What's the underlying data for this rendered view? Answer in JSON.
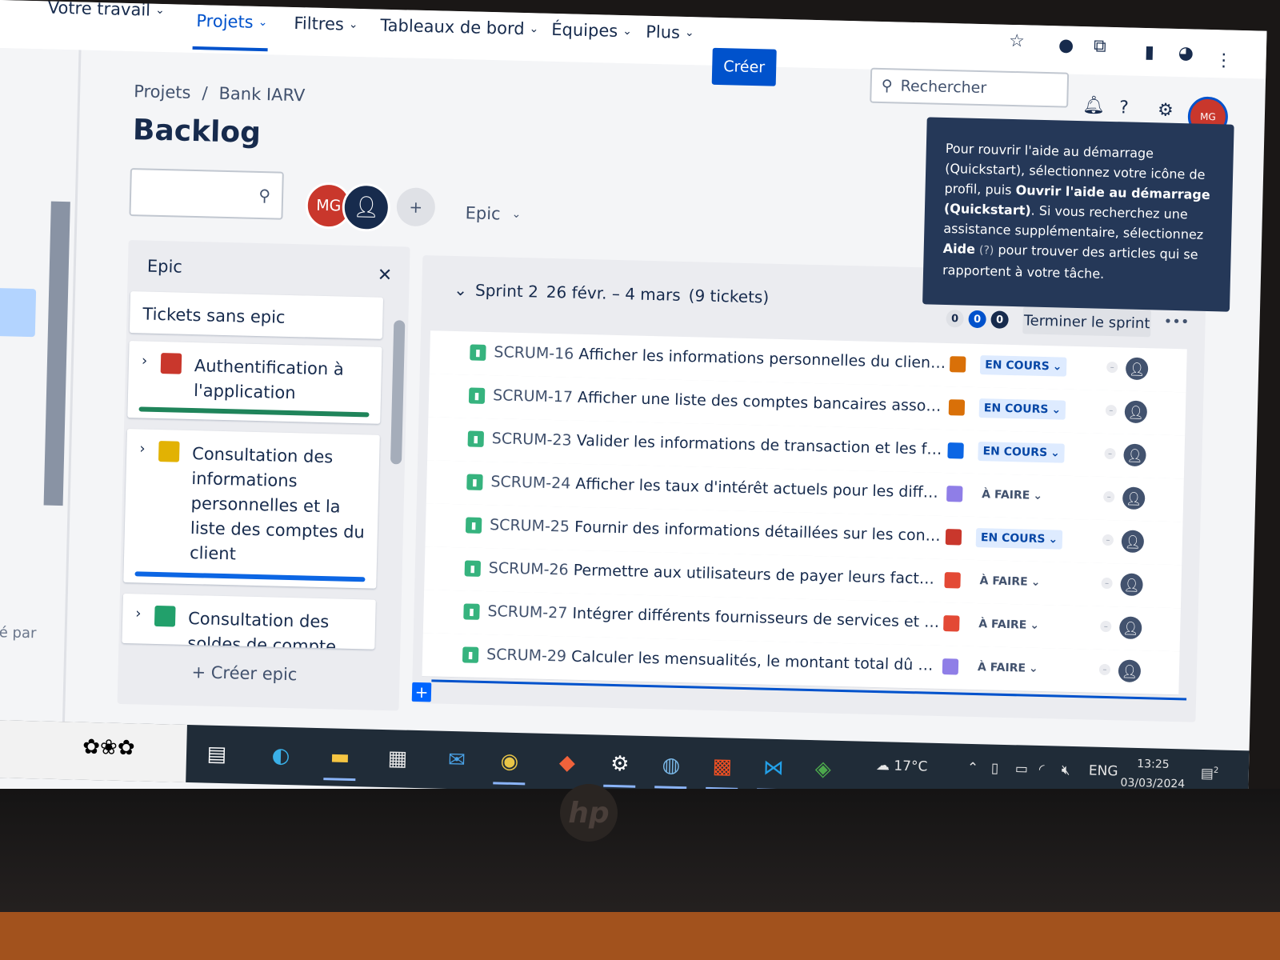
{
  "nav": {
    "items": [
      "Votre travail",
      "Projets",
      "Filtres",
      "Tableaux de bord",
      "Équipes",
      "Plus"
    ],
    "create_label": "Créer",
    "search_placeholder": "Rechercher",
    "profile_initials": "MG"
  },
  "breadcrumb": [
    "Projets",
    "/",
    "Bank IARV"
  ],
  "page_title": "Backlog",
  "toolbar": {
    "avatar_initials": "MG",
    "epic_filter_label": "Epic"
  },
  "left_rail": {
    "partial_text": "éré par"
  },
  "epic_panel": {
    "title": "Epic",
    "no_epic_label": "Tickets sans epic",
    "epics": [
      {
        "label": "Authentification à l'application",
        "color": "#c9372c",
        "bar_color": "#1f845a"
      },
      {
        "label": "Consultation des informations personnelles et la liste des comptes du client",
        "color": "#e2b203",
        "bar_color": "#0c66e4"
      },
      {
        "label": "Consultation des soldes de compte",
        "color": "#22a06b",
        "bar_color": "#ffffff"
      }
    ],
    "create_epic_label": "+ Créer epic"
  },
  "sprint": {
    "name": "Sprint 2",
    "dates": "26 févr. – 4 mars",
    "ticket_count": "(9 tickets)",
    "counts": [
      "0",
      "0",
      "0"
    ],
    "end_button": "Terminer le sprint",
    "more_label": "•••",
    "issues": [
      {
        "key": "SCRUM-16",
        "summary": "Afficher les informations personnelles du client telle...",
        "epic_color": "#d97008",
        "status": "EN COURS",
        "status_type": "inprog"
      },
      {
        "key": "SCRUM-17",
        "summary": "Afficher une liste des comptes bancaires associés a...",
        "epic_color": "#d97008",
        "status": "EN COURS",
        "status_type": "inprog"
      },
      {
        "key": "SCRUM-23",
        "summary": "Valider les informations de transaction et les fonds ...",
        "epic_color": "#0c66e4",
        "status": "EN COURS",
        "status_type": "inprog"
      },
      {
        "key": "SCRUM-24",
        "summary": "Afficher les taux d'intérêt actuels pour les différents...",
        "epic_color": "#8f7ee7",
        "status": "À FAIRE",
        "status_type": "todo"
      },
      {
        "key": "SCRUM-25",
        "summary": "Fournir des informations détaillées sur les condition...",
        "epic_color": "#c9372c",
        "status": "EN COURS",
        "status_type": "inprog"
      },
      {
        "key": "SCRUM-26",
        "summary": "Permettre aux utilisateurs de payer leurs factures à ...",
        "epic_color": "#e34935",
        "status": "À FAIRE",
        "status_type": "todo"
      },
      {
        "key": "SCRUM-27",
        "summary": "Intégrer différents fournisseurs de services et perm...",
        "epic_color": "#e34935",
        "status": "À FAIRE",
        "status_type": "todo"
      },
      {
        "key": "SCRUM-29",
        "summary": "Calculer les mensualités, le montant total dû et d'a...",
        "epic_color": "#8f7ee7",
        "status": "À FAIRE",
        "status_type": "todo"
      }
    ]
  },
  "tooltip": {
    "line1": "Pour rouvrir l'aide au démarrage (Quickstart), sélectionnez votre icône de profil, puis ",
    "bold1": "Ouvrir l'aide au démarrage (Quickstart)",
    "line2": ". Si vous recherchez une assistance supplémentaire, sélectionnez ",
    "bold2": "Aide",
    "aide_icon": "(?)",
    "line3": " pour trouver des articles qui se rapportent à votre tâche."
  },
  "taskbar": {
    "weather": "17°C",
    "language": "ENG",
    "time": "13:25",
    "date": "03/03/2024",
    "notification_count": "2"
  },
  "colors": {
    "brand": "#0052cc",
    "nav_bg": "#ffffff",
    "taskbar": "#202c38"
  }
}
